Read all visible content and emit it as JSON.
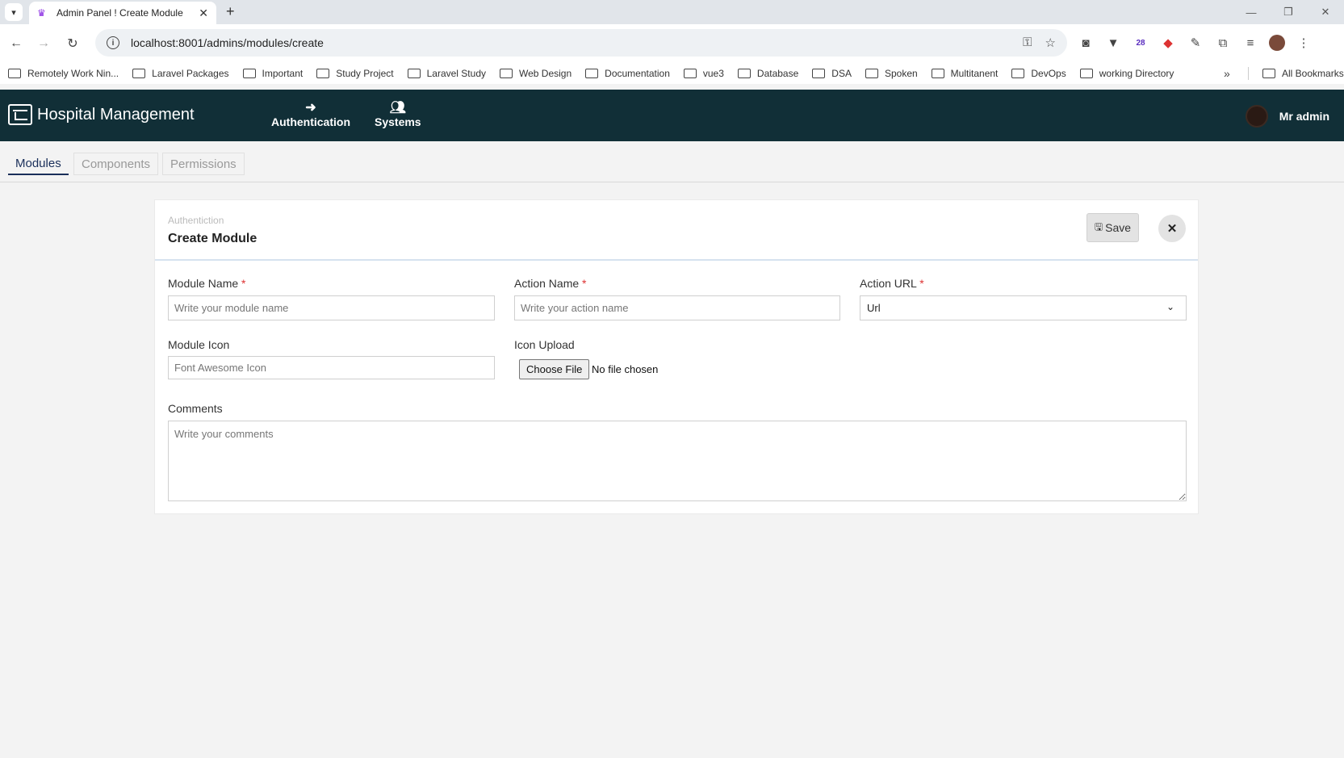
{
  "browser": {
    "tab_title": "Admin Panel ! Create Module",
    "url": "localhost:8001/admins/modules/create",
    "bookmarks": [
      "Remotely Work Nin...",
      "Laravel Packages",
      "Important",
      "Study Project",
      "Laravel Study",
      "Web Design",
      "Documentation",
      "vue3",
      "Database",
      "DSA",
      "Spoken",
      "Multitanent",
      "DevOps",
      "working Directory"
    ],
    "more_bookmarks": "»",
    "all_bookmarks": "All Bookmarks",
    "extension_badge": "28"
  },
  "app": {
    "brand": "Hospital Management",
    "nav": [
      {
        "label": "Authentication",
        "icon": "sign-in-icon"
      },
      {
        "label": "Systems",
        "icon": "users-icon"
      }
    ],
    "user_name": "Mr admin"
  },
  "subtabs": [
    "Modules",
    "Components",
    "Permissions"
  ],
  "form": {
    "breadcrumb": "Authentiction",
    "title": "Create Module",
    "save_label": "Save",
    "module_name": {
      "label": "Module Name",
      "required": "*",
      "placeholder": "Write your module name"
    },
    "action_name": {
      "label": "Action Name",
      "required": "*",
      "placeholder": "Write your action name"
    },
    "action_url": {
      "label": "Action URL",
      "required": "*",
      "selected": "Url"
    },
    "module_icon": {
      "label": "Module Icon",
      "placeholder": "Font Awesome Icon"
    },
    "icon_upload": {
      "label": "Icon Upload",
      "button": "Choose File",
      "status": "No file chosen"
    },
    "comments": {
      "label": "Comments",
      "placeholder": "Write your comments"
    }
  }
}
